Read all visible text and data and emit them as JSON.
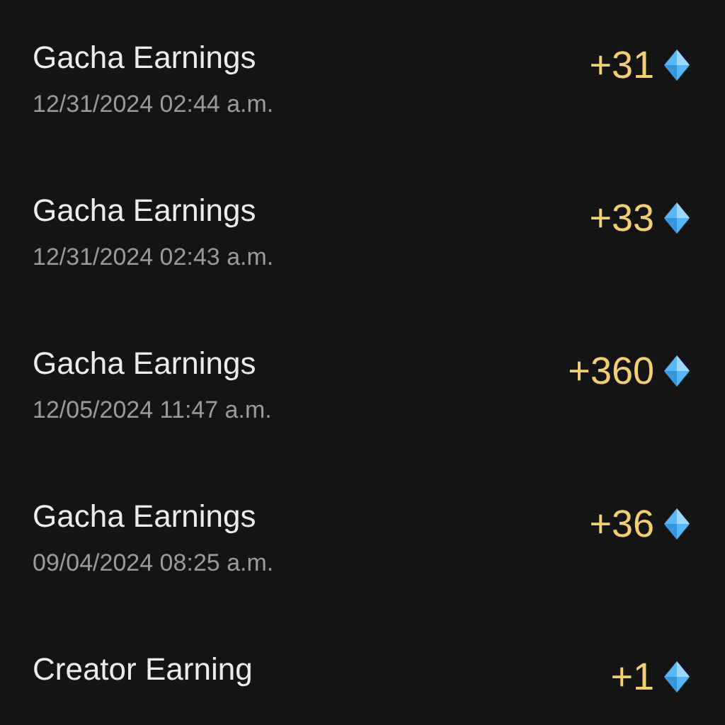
{
  "transactions": [
    {
      "title": "Gacha Earnings",
      "date": "12/31/2024 02:44 a.m.",
      "amount": "+31"
    },
    {
      "title": "Gacha Earnings",
      "date": "12/31/2024 02:43 a.m.",
      "amount": "+33"
    },
    {
      "title": "Gacha Earnings",
      "date": "12/05/2024 11:47 a.m.",
      "amount": "+360"
    },
    {
      "title": "Gacha Earnings",
      "date": "09/04/2024 08:25 a.m.",
      "amount": "+36"
    },
    {
      "title": "Creator Earning",
      "amount": "+1"
    }
  ]
}
